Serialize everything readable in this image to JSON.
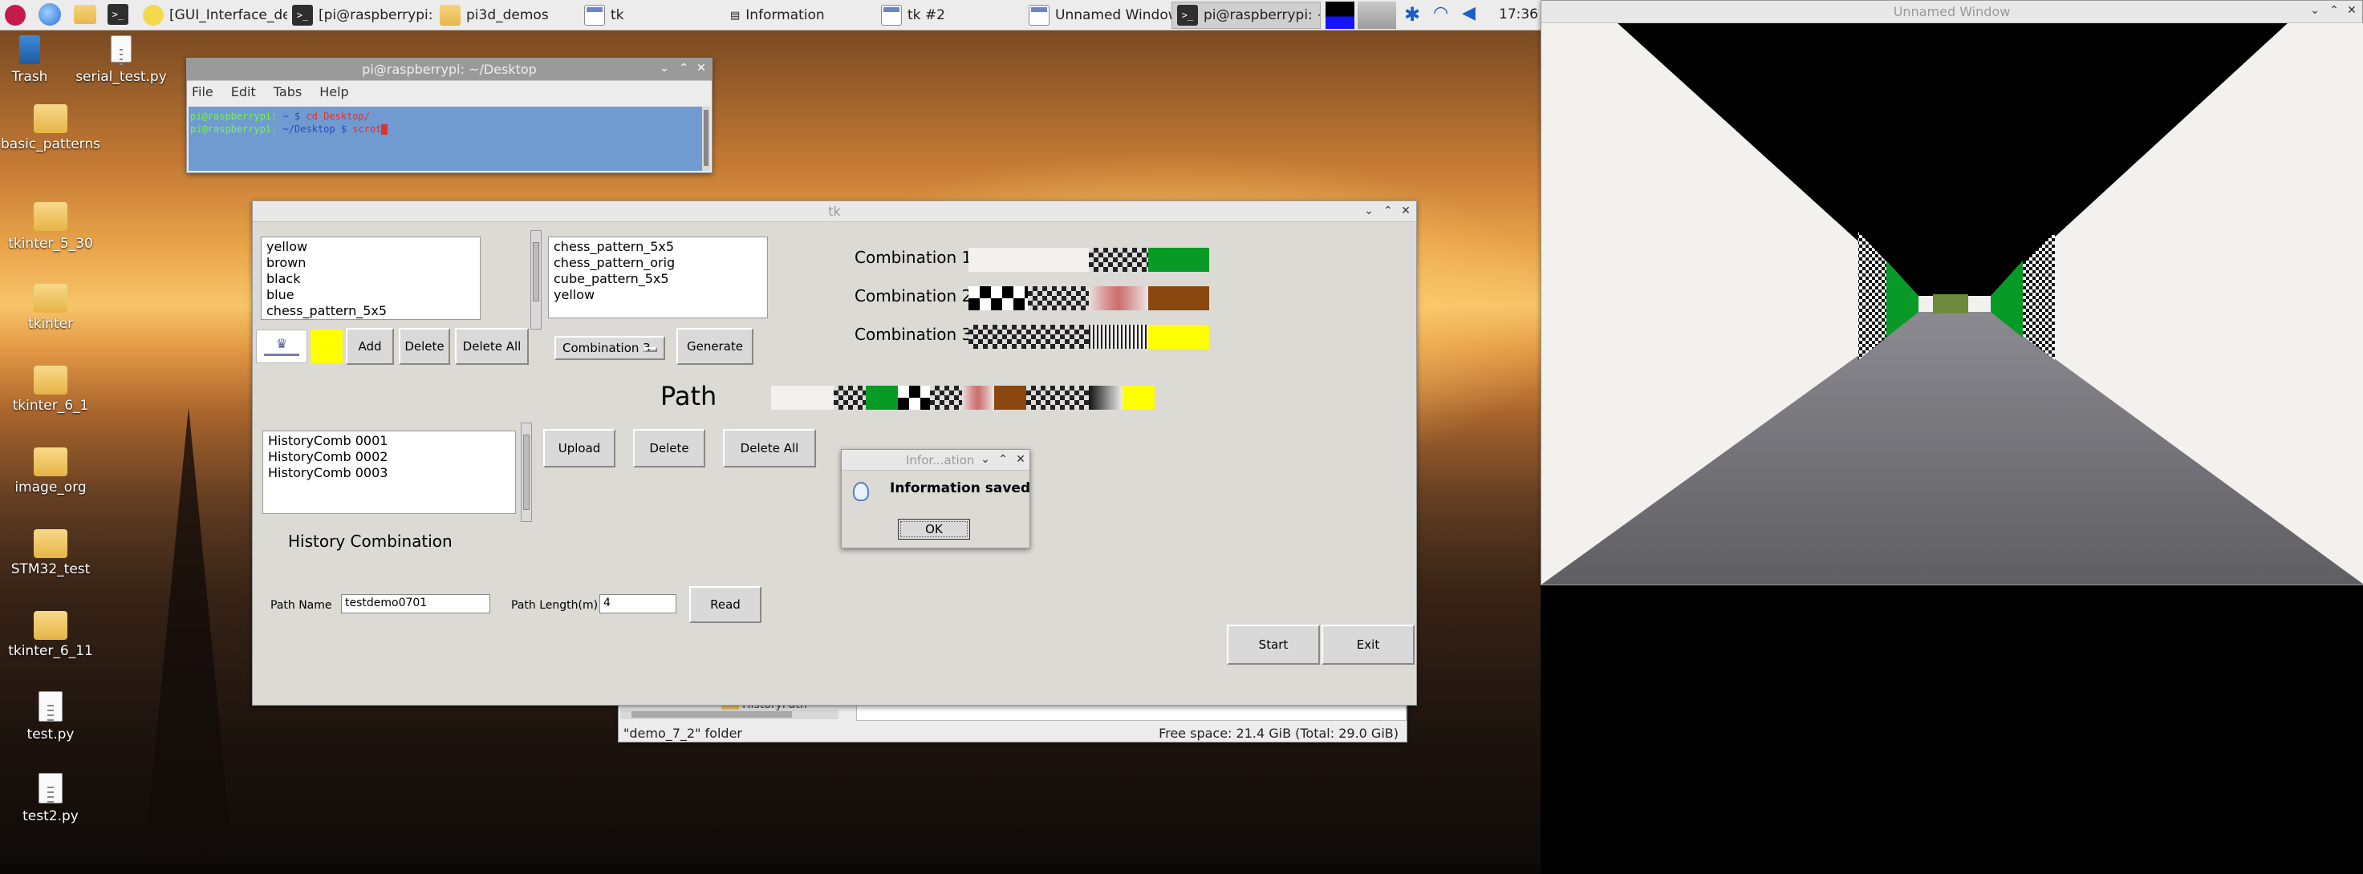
{
  "taskbar": {
    "items": [
      {
        "label": "[GUI_Interface_dem...",
        "icon": "python-file-icon"
      },
      {
        "label": "[pi@raspberrypi: ~/...",
        "icon": "terminal-icon"
      },
      {
        "label": "pi3d_demos",
        "icon": "folder-icon"
      },
      {
        "label": "tk",
        "icon": "tk-window-icon"
      },
      {
        "label": "Information",
        "icon": "info-window-icon"
      },
      {
        "label": "tk #2",
        "icon": "tk-window-icon"
      },
      {
        "label": "Unnamed Window",
        "icon": "tk-window-icon"
      },
      {
        "label": "pi@raspberrypi: ~/...",
        "icon": "terminal-icon"
      }
    ],
    "clock": "17:36"
  },
  "desktop": {
    "icons": [
      {
        "label": "Trash",
        "kind": "trash"
      },
      {
        "label": "serial_test.py",
        "kind": "doc"
      },
      {
        "label": "basic_patterns",
        "kind": "folder"
      },
      {
        "label": "tkinter_5_30",
        "kind": "folder"
      },
      {
        "label": "tkinter",
        "kind": "folder"
      },
      {
        "label": "tkinter_6_1",
        "kind": "folder"
      },
      {
        "label": "image_org",
        "kind": "folder"
      },
      {
        "label": "STM32_test",
        "kind": "folder"
      },
      {
        "label": "tkinter_6_11",
        "kind": "folder"
      },
      {
        "label": "test.py",
        "kind": "doc"
      },
      {
        "label": "test2.py",
        "kind": "doc"
      }
    ]
  },
  "terminal": {
    "title": "pi@raspberrypi: ~/Desktop",
    "menu": [
      "File",
      "Edit",
      "Tabs",
      "Help"
    ],
    "line1_prompt": "pi@raspberrypi:",
    "line1_path": "~ $",
    "line1_cmd": "cd Desktop/",
    "line2_prompt": "pi@raspberrypi:",
    "line2_path": "~/Desktop $",
    "line2_cmd": "scrot"
  },
  "tk": {
    "title": "tk",
    "colors": [
      "yellow",
      "brown",
      "black",
      "blue",
      "chess_pattern_5x5"
    ],
    "selected": [
      "chess_pattern_5x5",
      "chess_pattern_orig",
      "cube_pattern_5x5",
      "yellow"
    ],
    "add": "Add",
    "delete": "Delete",
    "delete_all": "Delete All",
    "combo": "Combination 3",
    "generate": "Generate",
    "combinations": [
      {
        "label": "Combination 1",
        "segments": [
          "light",
          "checker",
          "green"
        ]
      },
      {
        "label": "Combination 2",
        "segments": [
          "bw-blocks",
          "checker",
          "blur",
          "brown"
        ]
      },
      {
        "label": "Combination 3",
        "segments": [
          "checker",
          "gradient",
          "yellow"
        ]
      }
    ],
    "path_label": "Path",
    "history": [
      "HistoryComb 0001",
      "HistoryComb 0002",
      "HistoryComb 0003"
    ],
    "upload": "Upload",
    "delete2": "Delete",
    "delete_all2": "Delete All",
    "history_label": "History Combination",
    "path_name_label": "Path Name",
    "path_name_value": "testdemo0701",
    "path_length_label": "Path Length(m)",
    "path_length_value": "4",
    "read": "Read",
    "start": "Start",
    "exit": "Exit"
  },
  "info_dialog": {
    "title": "Infor...ation",
    "message": "Information saved",
    "ok": "OK"
  },
  "file_manager": {
    "folder_label": "HistoryPath",
    "status_left": "\"demo_7_2\" folder",
    "status_right": "Free space: 21.4 GiB (Total: 29.0 GiB)"
  },
  "unnamed_window": {
    "title": "Unnamed Window"
  },
  "colors": {
    "green": "#089a26",
    "brown": "#8b4710",
    "yellow": "#ffff00",
    "terminal_bg": "#6f9bd1"
  }
}
